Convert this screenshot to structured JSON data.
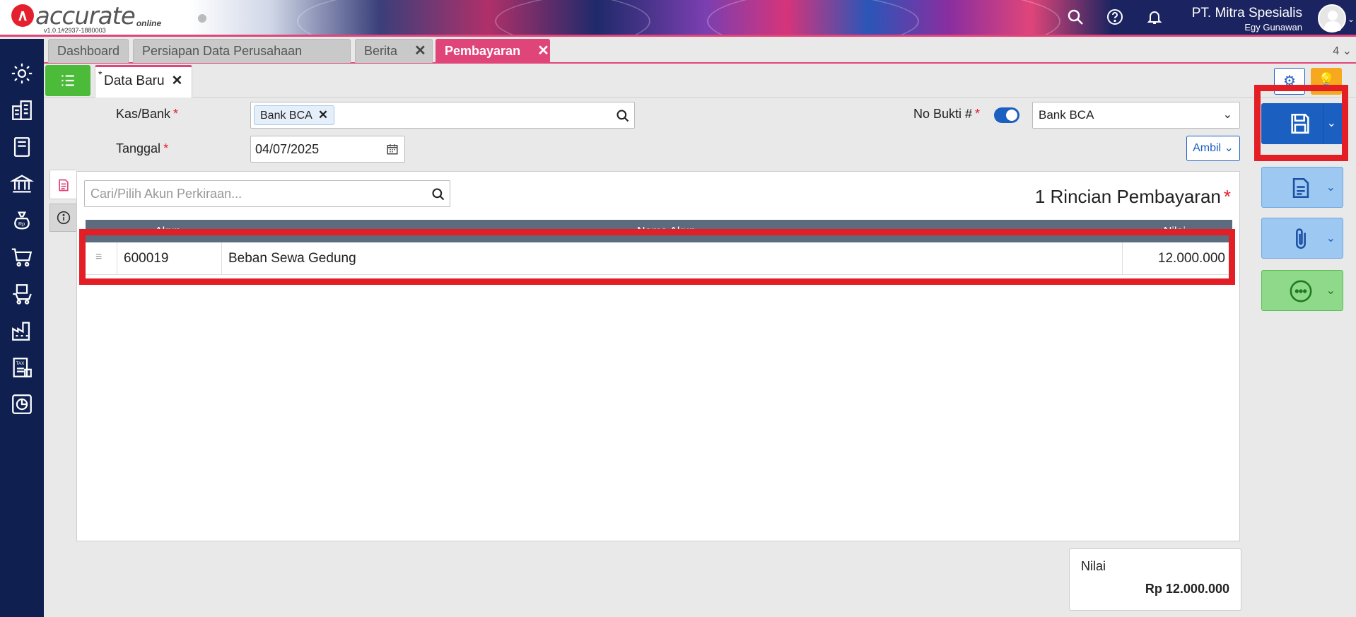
{
  "app": {
    "logo_text": "accurate",
    "logo_sub": "online",
    "version": "v1.0.1#2937-1880003",
    "company": "PT. Mitra Spesialis",
    "user": "Egy Gunawan"
  },
  "module_tabs": [
    {
      "label": "Dashboard"
    },
    {
      "label": "Persiapan Data Perusahaan"
    },
    {
      "label": "Berita"
    },
    {
      "label": "Pembayaran"
    }
  ],
  "tab_count": "4",
  "doc_tab": {
    "star": "*",
    "label": "Data Baru"
  },
  "form": {
    "kas_bank_label": "Kas/Bank",
    "kas_bank_value": "Bank BCA",
    "tanggal_label": "Tanggal",
    "tanggal_value": "04/07/2025",
    "no_bukti_label": "No Bukti #",
    "no_bukti_select": "Bank BCA",
    "ambil_label": "Ambil",
    "required_mark": "*"
  },
  "detail": {
    "search_placeholder": "Cari/Pilih Akun Perkiraan...",
    "title": "1 Rincian Pembayaran",
    "columns": [
      "Akun",
      "Nama Akun",
      "Nilai"
    ],
    "rows": [
      {
        "akun": "600019",
        "nama": "Beban Sewa Gedung",
        "nilai": "12.000.000"
      }
    ]
  },
  "total": {
    "label": "Nilai",
    "value": "Rp 12.000.000"
  },
  "colors": {
    "brand": "#e0457a",
    "sidebar": "#0f2050",
    "primary": "#1b5fc1",
    "highlight": "#e31e24"
  }
}
